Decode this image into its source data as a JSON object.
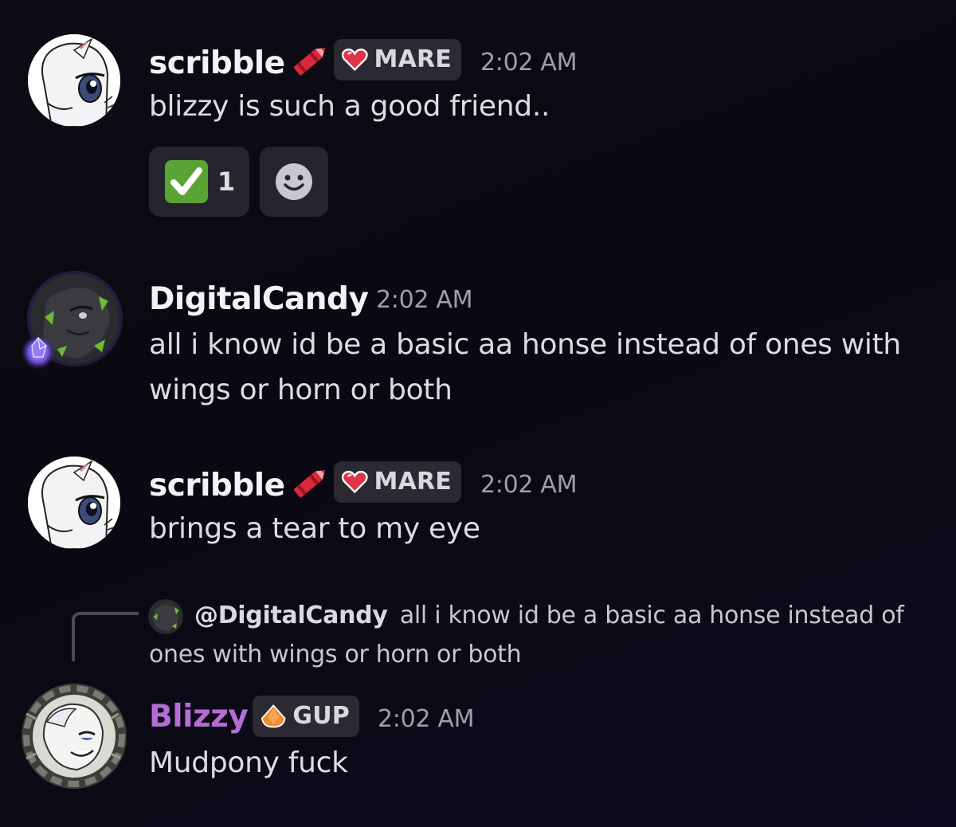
{
  "messages": [
    {
      "author": "scribble",
      "author_color": "#f2f3f5",
      "name_icon": "crayon-icon",
      "tag": {
        "icon": "heart-icon",
        "label": "MARE"
      },
      "timestamp": "2:02 AM",
      "text": "blizzy is such a good friend..",
      "reactions": [
        {
          "emoji": "white-check-mark",
          "count": "1"
        }
      ],
      "add_reaction_icon": "smile-icon"
    },
    {
      "author": "DigitalCandy",
      "author_color": "#f2f3f5",
      "timestamp": "2:02 AM",
      "text_lines": [
        "all i know id be a basic aa honse instead of ones with",
        "wings or horn or both"
      ]
    },
    {
      "author": "scribble",
      "author_color": "#f2f3f5",
      "name_icon": "crayon-icon",
      "tag": {
        "icon": "heart-icon",
        "label": "MARE"
      },
      "timestamp": "2:02 AM",
      "text": "brings a tear to my eye"
    },
    {
      "reply": {
        "mention": "@DigitalCandy",
        "line1": "all i know id be a basic aa honse instead of",
        "line2": "ones with wings or horn or both"
      },
      "author": "Blizzy",
      "author_color": "#b56dd6",
      "tag": {
        "icon": "orange-gem-icon",
        "label": "GUP"
      },
      "timestamp": "2:02 AM",
      "text": "Mudpony fuck"
    }
  ],
  "colors": {
    "background": "#0b0a12",
    "tag_bg": "#2b2a33",
    "reaction_bg": "#26252d",
    "check_green": "#5aa335",
    "heart_red": "#e0334a",
    "gem_orange": "#ef8d32",
    "blizzy_purple": "#b56dd6"
  }
}
